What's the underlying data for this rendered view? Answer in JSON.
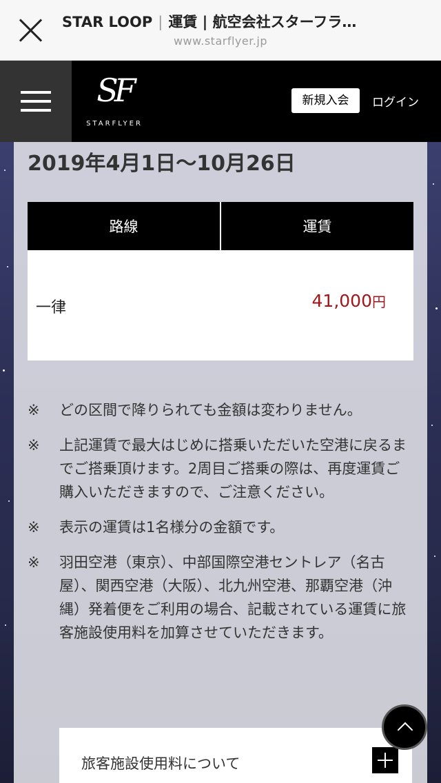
{
  "browser": {
    "site_name": "STAR LOOP",
    "page_title": "運賃 | 航空会社スターフラ…",
    "url": "www.starflyer.jp"
  },
  "header": {
    "logo_mark": "SF",
    "logo_text": "STARFLYER",
    "join_label": "新規入会",
    "login_label": "ログイン"
  },
  "content": {
    "period": "2019年4月1日〜10月26日",
    "table": {
      "headers": [
        "路線",
        "運賃"
      ],
      "rows": [
        {
          "route": "一律",
          "fare": "41,000",
          "unit": "円"
        }
      ]
    },
    "notes": [
      {
        "mark": "※",
        "text": "どの区間で降りられても金額は変わりません。"
      },
      {
        "mark": "※",
        "text": "上記運賃で最大はじめに搭乗いただいた空港に戻るまでご搭乗頂けます。2周目ご搭乗の際は、再度運賃ご購入いただきますので、ご注意ください。"
      },
      {
        "mark": "※",
        "text": "表示の運賃は1名様分の金額です。"
      },
      {
        "mark": "※",
        "text": "羽田空港（東京）、中部国際空港セントレア（名古屋）、関西空港（大阪）、北九州空港、那覇空港（沖縄）発着便をご利用の場合、記載されている運賃に旅客施設使用料を加算させていただきます。"
      }
    ],
    "accordion_label": "旅客施設使用料について"
  },
  "colors": {
    "price": "#a2161a",
    "header_bg": "#000000",
    "panel_bg": "#e2e2e9"
  },
  "icons": [
    "close-icon",
    "hamburger-icon",
    "plus-icon",
    "chevron-up-icon"
  ]
}
